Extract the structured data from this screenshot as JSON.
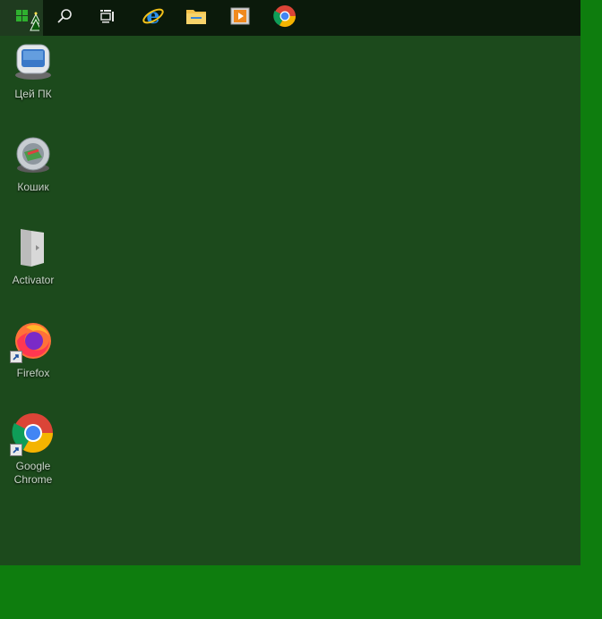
{
  "taskbar": {
    "buttons": [
      {
        "name": "start-button",
        "icon": "start-tree-icon"
      },
      {
        "name": "search-button",
        "icon": "search-icon"
      },
      {
        "name": "task-view-button",
        "icon": "task-view-icon"
      },
      {
        "name": "internet-explorer-button",
        "icon": "internet-explorer-icon"
      },
      {
        "name": "file-explorer-button",
        "icon": "folder-icon"
      },
      {
        "name": "media-player-button",
        "icon": "media-player-icon"
      },
      {
        "name": "chrome-button",
        "icon": "chrome-icon"
      }
    ]
  },
  "desktop": {
    "icons": [
      {
        "label": "Цей ПК",
        "icon": "computer-icon"
      },
      {
        "label": "Кошик",
        "icon": "recycle-bin-icon"
      },
      {
        "label": "Activator",
        "icon": "activator-icon"
      },
      {
        "label": "Firefox",
        "icon": "firefox-icon"
      },
      {
        "label": "Google Chrome",
        "icon": "chrome-icon"
      }
    ]
  },
  "colors": {
    "desktop": "#1c4a1c",
    "outer_background": "#0e7d0e",
    "taskbar": "#0b1a0b",
    "label_text": "#c9d6c9"
  }
}
